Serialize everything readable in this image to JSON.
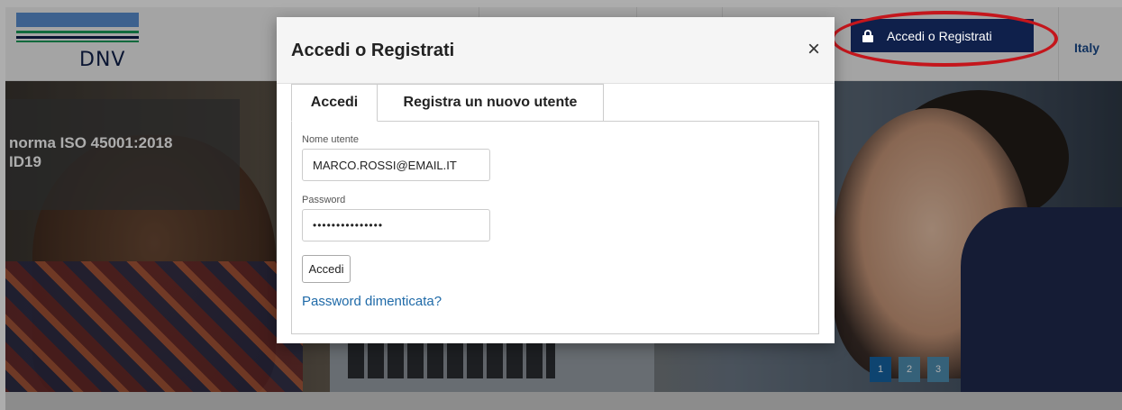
{
  "header": {
    "logo_text": "DNV",
    "login_button_label": "Accedi o Registrati",
    "country": "Italy"
  },
  "hero": {
    "caption_line1": "norma ISO 45001:2018",
    "caption_line2": "ID19",
    "slides": [
      "1",
      "2",
      "3"
    ],
    "active_slide": "1"
  },
  "modal": {
    "title": "Accedi o Registrati",
    "close_glyph": "×",
    "tabs": [
      {
        "label": "Accedi",
        "active": true
      },
      {
        "label": "Registra un nuovo utente",
        "active": false
      }
    ],
    "username_label": "Nome utente",
    "username_value": "MARCO.ROSSI@EMAIL.IT",
    "password_label": "Password",
    "password_value": "•••••••••••••••",
    "submit_label": "Accedi",
    "forgot_link": "Password dimenticata?"
  },
  "colors": {
    "brand_navy": "#0f204b",
    "highlight_red": "#c4161c",
    "link_blue": "#1f6aa8",
    "slide_active": "#1565a6",
    "slide_inactive": "#4f8fb3"
  },
  "icons": {
    "lock": "lock-icon",
    "close": "close-icon"
  }
}
